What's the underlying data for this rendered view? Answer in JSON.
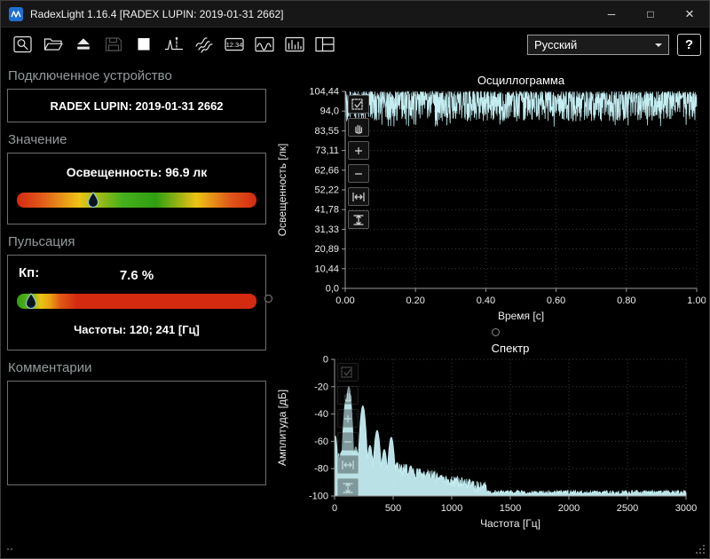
{
  "window": {
    "title": "RadexLight 1.16.4 [RADEX LUPIN: 2019-01-31 2662]",
    "controls": {
      "minimize": "─",
      "maximize": "□",
      "close": "×"
    }
  },
  "toolbar": {
    "buttons": [
      {
        "name": "search-device-button",
        "icon": "magnifier-icon"
      },
      {
        "name": "open-file-button",
        "icon": "folder-open-icon"
      },
      {
        "name": "eject-button",
        "icon": "eject-icon"
      },
      {
        "name": "save-button",
        "icon": "floppy-icon",
        "disabled": true
      },
      {
        "name": "stop-button",
        "icon": "stop-square-icon"
      },
      {
        "name": "single-measurement-button",
        "icon": "waveform-marker-icon"
      },
      {
        "name": "continuous-measurement-button",
        "icon": "waveforms-icon"
      },
      {
        "name": "numeric-view-button",
        "icon": "digits-icon",
        "label": "12.34"
      },
      {
        "name": "oscillogram-view-button",
        "icon": "oscillogram-icon"
      },
      {
        "name": "spectrum-view-button",
        "icon": "spectrum-icon"
      },
      {
        "name": "layout-view-button",
        "icon": "layout-icon"
      }
    ],
    "language_select": {
      "value": "Русский"
    },
    "help_button_label": "?"
  },
  "device_panel": {
    "section_title": "Подключенное устройство",
    "device_name": "RADEX LUPIN: 2019-01-31 2662"
  },
  "value_panel": {
    "section_title": "Значение",
    "reading": "Освещенность: 96.9 лк",
    "marker_pct": 32
  },
  "pulsation_panel": {
    "section_title": "Пульсация",
    "kp_label": "Кп:",
    "kp_value": "7.6 %",
    "frequencies": "Частоты: 120; 241 [Гц]",
    "marker_pct": 6
  },
  "comments_panel": {
    "section_title": "Комментарии",
    "text": ""
  },
  "chart_tools": {
    "buttons": [
      {
        "name": "zoom-select-button",
        "icon": "check-select-icon"
      },
      {
        "name": "pan-button",
        "icon": "hand-icon"
      },
      {
        "name": "zoom-in-button",
        "icon": "plus-icon"
      },
      {
        "name": "zoom-out-button",
        "icon": "minus-icon"
      },
      {
        "name": "fit-horizontal-button",
        "icon": "fit-horizontal-icon"
      },
      {
        "name": "fit-vertical-button",
        "icon": "fit-vertical-icon"
      }
    ]
  },
  "chart_data": [
    {
      "id": "oscillogram",
      "type": "line",
      "title": "Осциллограмма",
      "xlabel": "Время [с]",
      "ylabel": "Освещенность [лк]",
      "xlim": [
        0,
        1
      ],
      "ylim": [
        0,
        104.44
      ],
      "xticks": [
        "0.00",
        "0.20",
        "0.40",
        "0.60",
        "0.80",
        "1.00"
      ],
      "xtick_values": [
        0,
        0.2,
        0.4,
        0.6,
        0.8,
        1
      ],
      "yticks": [
        "0,0",
        "10,44",
        "20,89",
        "31,33",
        "41,78",
        "52,22",
        "62,66",
        "73,11",
        "83,55",
        "94,0",
        "104,44"
      ],
      "ytick_values": [
        0,
        10.44,
        20.89,
        31.33,
        41.78,
        52.22,
        62.66,
        73.11,
        83.55,
        94.0,
        104.44
      ],
      "grid": "dotted",
      "legend": "none",
      "line_color": "#c4eef2",
      "series": {
        "name": "освещенность",
        "mean": 96.9,
        "band_min": 88.5,
        "band_max": 104.4,
        "dip_min": 85.5,
        "samples": 1400,
        "seed": 1234
      }
    },
    {
      "id": "spectrum",
      "type": "area",
      "title": "Спектр",
      "xlabel": "Частота [Гц]",
      "ylabel": "Амплитуда [дБ]",
      "xlim": [
        0,
        3000
      ],
      "ylim": [
        -100,
        0
      ],
      "xticks": [
        "0",
        "500",
        "1000",
        "1500",
        "2000",
        "2500",
        "3000"
      ],
      "xtick_values": [
        0,
        500,
        1000,
        1500,
        2000,
        2500,
        3000
      ],
      "yticks": [
        "0",
        "-20",
        "-40",
        "-60",
        "-80",
        "-100"
      ],
      "ytick_values": [
        0,
        -20,
        -40,
        -60,
        -80,
        -100
      ],
      "grid": "dotted",
      "legend": "none",
      "fill_color": "#c4eef2",
      "baseline": {
        "start_db": -74,
        "knee_hz": 1300,
        "floor_db": -99,
        "noise_db": 9
      },
      "peaks": [
        [
          6,
          -56,
          24
        ],
        [
          63,
          -67,
          28
        ],
        [
          100,
          -29,
          34
        ],
        [
          121,
          -20,
          36
        ],
        [
          181,
          -64,
          40
        ],
        [
          241,
          -34,
          40
        ],
        [
          302,
          -63,
          44
        ],
        [
          363,
          -52,
          46
        ],
        [
          424,
          -66,
          44
        ],
        [
          484,
          -57,
          46
        ],
        [
          650,
          -78,
          60
        ],
        [
          905,
          -85,
          60
        ],
        [
          1110,
          -90,
          60
        ]
      ],
      "seed": 99
    }
  ]
}
